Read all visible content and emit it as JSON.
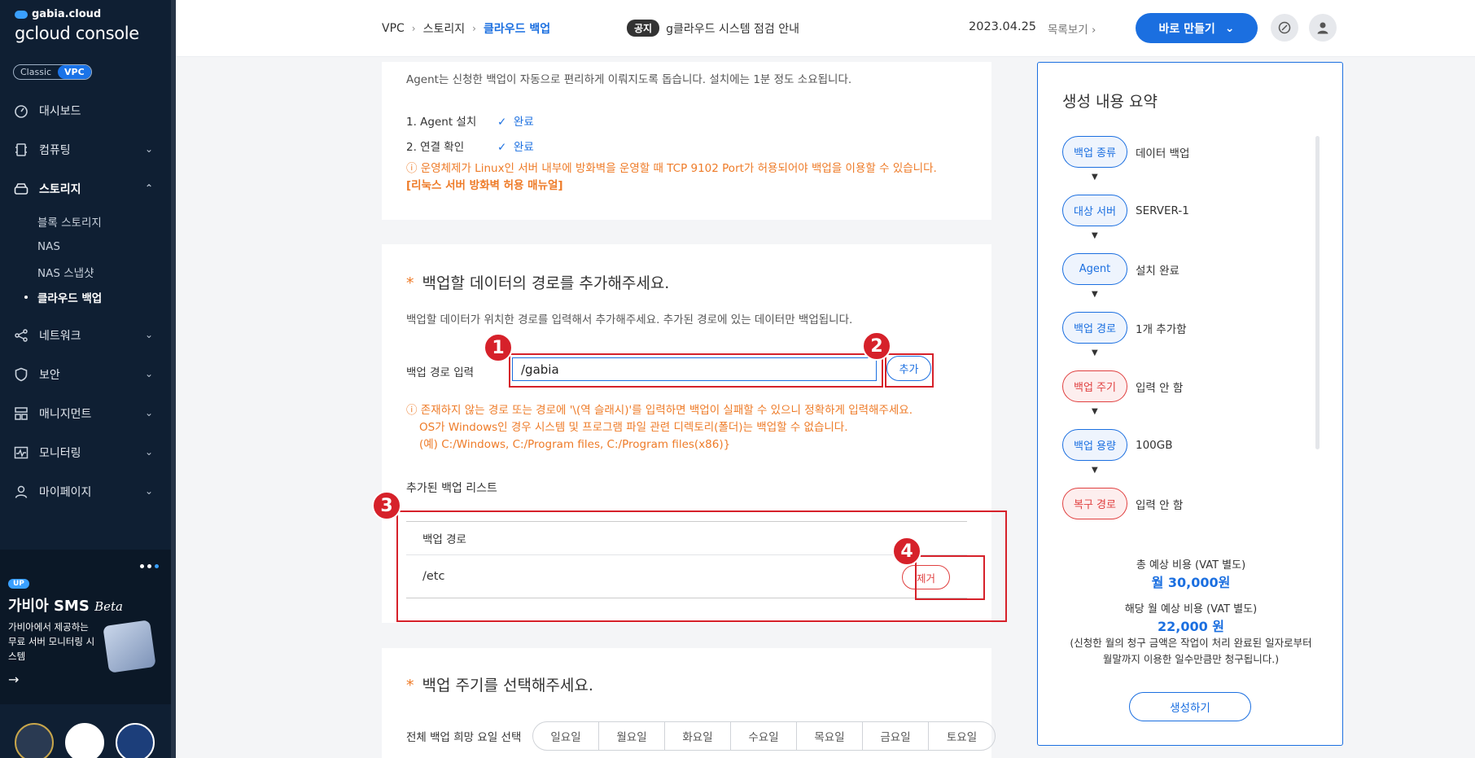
{
  "brand": {
    "top": "gabia.cloud",
    "main": "gcloud console"
  },
  "mode_toggle": {
    "classic": "Classic",
    "vpc": "VPC"
  },
  "sidebar": {
    "items": [
      {
        "label": "대시보드",
        "icon": "dashboard-icon"
      },
      {
        "label": "컴퓨팅",
        "icon": "compute-icon"
      },
      {
        "label": "스토리지",
        "icon": "storage-icon"
      },
      {
        "label": "네트워크",
        "icon": "network-icon"
      },
      {
        "label": "보안",
        "icon": "shield-icon"
      },
      {
        "label": "매니지먼트",
        "icon": "management-icon"
      },
      {
        "label": "모니터링",
        "icon": "monitoring-icon"
      },
      {
        "label": "마이페이지",
        "icon": "user-icon"
      }
    ],
    "storage_sub": [
      "블록 스토리지",
      "NAS",
      "NAS 스냅샷",
      "클라우드 백업"
    ]
  },
  "promo": {
    "badge": "UP",
    "title": "가비아 SMS",
    "title_beta": "Beta",
    "desc": "가비아에서 제공하는 무료 서버 모니터링 시스템"
  },
  "topbar": {
    "breadcrumb": [
      "VPC",
      "스토리지",
      "클라우드 백업"
    ],
    "notice_tag": "공지",
    "notice_text": "g클라우드 시스템 점검 안내",
    "notice_date": "2023.04.25",
    "notice_list": "목록보기",
    "create_button": "바로 만들기"
  },
  "agent_card": {
    "desc": "Agent는 신청한 백업이 자동으로 편리하게 이뤄지도록 돕습니다. 설치에는 1분 정도 소요됩니다.",
    "steps": [
      {
        "label": "1. Agent 설치",
        "status": "완료"
      },
      {
        "label": "2. 연결 확인",
        "status": "완료"
      }
    ],
    "warning": "ⓘ 운영체제가 Linux인 서버 내부에 방화벽을 운영할 때 TCP 9102 Port가 허용되어야 백업을 이용할 수 있습니다.",
    "warning_link": "[리눅스 서버 방화벽 허용 매뉴얼]"
  },
  "path_card": {
    "title": "백업할 데이터의 경로를 추가해주세요.",
    "desc": "백업할 데이터가 위치한 경로를 입력해서 추가해주세요. 추가된 경로에 있는 데이터만 백업됩니다.",
    "input_label": "백업 경로 입력",
    "input_value": "/gabia",
    "add_button": "추가",
    "warnings": [
      "ⓘ 존재하지 않는 경로 또는 경로에 '\\(역 슬래시)'를 입력하면 백업이 실패할 수 있으니 정확하게 입력해주세요.",
      "OS가 Windows인 경우 시스템 및 프로그램 파일 관련 디렉토리(폴더)는 백업할 수 없습니다.",
      "(예) C:/Windows, C:/Program files, C:/Program files(x86)}"
    ],
    "list_title": "추가된 백업 리스트",
    "table_header": "백업 경로",
    "rows": [
      {
        "path": "/etc",
        "remove": "제거"
      }
    ]
  },
  "cycle_card": {
    "title": "백업 주기를 선택해주세요.",
    "day_label": "전체 백업 희망 요일 선택",
    "days": [
      "일요일",
      "월요일",
      "화요일",
      "수요일",
      "목요일",
      "금요일",
      "토요일"
    ]
  },
  "annotations": [
    "1",
    "2",
    "3",
    "4"
  ],
  "summary": {
    "title": "생성 내용 요약",
    "rows": [
      {
        "pill": "백업 종류",
        "value": "데이터 백업",
        "state": "done"
      },
      {
        "pill": "대상 서버",
        "value": "SERVER-1",
        "state": "done"
      },
      {
        "pill": "Agent",
        "value": "설치 완료",
        "state": "done"
      },
      {
        "pill": "백업 경로",
        "value": "1개 추가함",
        "state": "done"
      },
      {
        "pill": "백업 주기",
        "value": "입력 안 함",
        "state": "missing"
      },
      {
        "pill": "백업 용량",
        "value": "100GB",
        "state": "done"
      },
      {
        "pill": "복구 경로",
        "value": "입력 안 함",
        "state": "missing"
      }
    ],
    "total_label": "총 예상 비용 (VAT 별도)",
    "total_value": "월 30,000원",
    "month_label": "해당 월 예상 비용 (VAT 별도)",
    "month_value": "22,000 원",
    "note_line1": "(신청한 월의 청구 금액은 작업이 처리 완료된 일자로부터",
    "note_line2": "월말까지 이용한 일수만큼만 청구됩니다.)",
    "create_button": "생성하기"
  },
  "colors": {
    "accent": "#1b6fe0",
    "warning": "#ee7b28",
    "annotation": "#d6212a",
    "sidebar": "#0f1f33"
  }
}
